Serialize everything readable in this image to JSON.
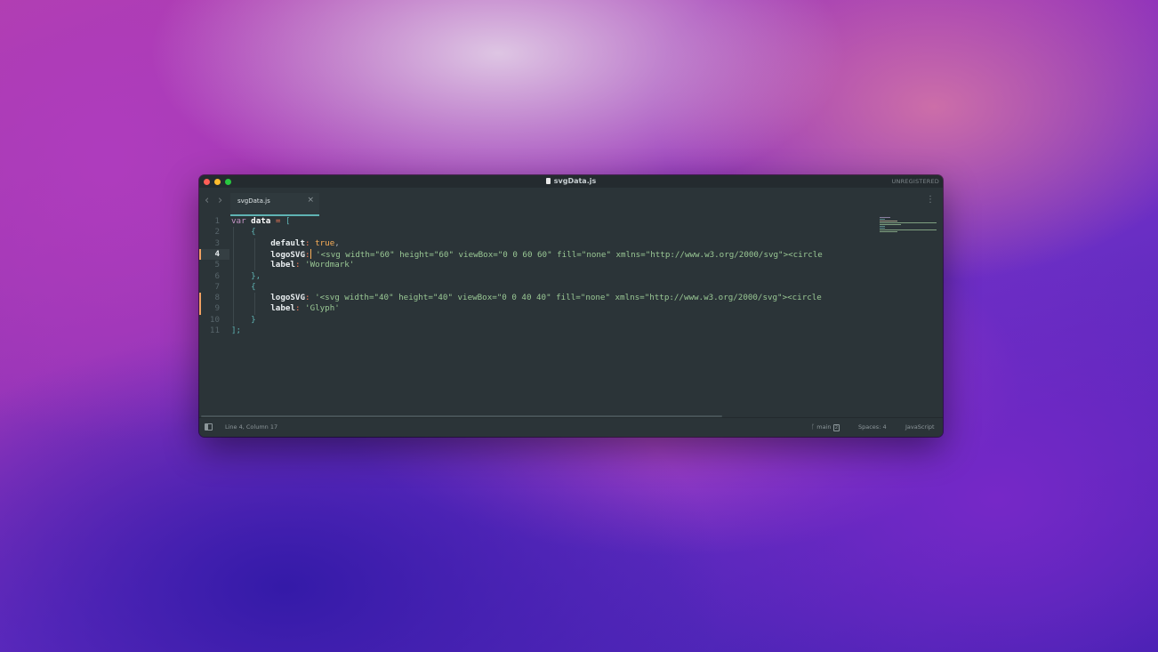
{
  "window": {
    "title": "svgData.js",
    "unregistered": "UNREGISTERED"
  },
  "tabs": [
    {
      "label": "svgData.js",
      "close": "×"
    }
  ],
  "nav": {
    "back": "‹",
    "forward": "›"
  },
  "menu": {
    "dots": "⋮"
  },
  "editor": {
    "line_numbers": [
      "1",
      "2",
      "3",
      "4",
      "5",
      "6",
      "7",
      "8",
      "9",
      "10",
      "11"
    ],
    "active_line": 4,
    "code": {
      "l1_var": "var",
      "l1_name": "data",
      "l1_eq": "=",
      "l1_bracket": "[",
      "l2_brace": "{",
      "l3_key": "default",
      "l3_colon": ":",
      "l3_val": "true",
      "l3_comma": ",",
      "l4_key": "logoSVG",
      "l4_colon": ":",
      "l4_str": "'<svg width=\"60\" height=\"60\" viewBox=\"0 0 60 60\" fill=\"none\" xmlns=\"http://www.w3.org/2000/svg\"><circle",
      "l5_key": "label",
      "l5_colon": ":",
      "l5_str": "'Wordmark'",
      "l6_brace": "},",
      "l7_brace": "{",
      "l8_key": "logoSVG",
      "l8_colon": ":",
      "l8_str": "'<svg width=\"40\" height=\"40\" viewBox=\"0 0 40 40\" fill=\"none\" xmlns=\"http://www.w3.org/2000/svg\"><circle",
      "l9_key": "label",
      "l9_colon": ":",
      "l9_str": "'Glyph'",
      "l10_brace": "}",
      "l11_close": "];"
    }
  },
  "status": {
    "position": "Line 4, Column 17",
    "branch_icon": "ᚴ",
    "branch": "main",
    "branch_badge": "2",
    "spaces": "Spaces: 4",
    "syntax": "JavaScript"
  },
  "colors": {
    "editor_bg": "#2b3438",
    "tab_accent": "#5fb3b3",
    "keyword": "#c594c5",
    "string": "#99c794",
    "boolean": "#f9ae58",
    "operator": "#f97b58",
    "modified_marker": "#f0a062"
  }
}
